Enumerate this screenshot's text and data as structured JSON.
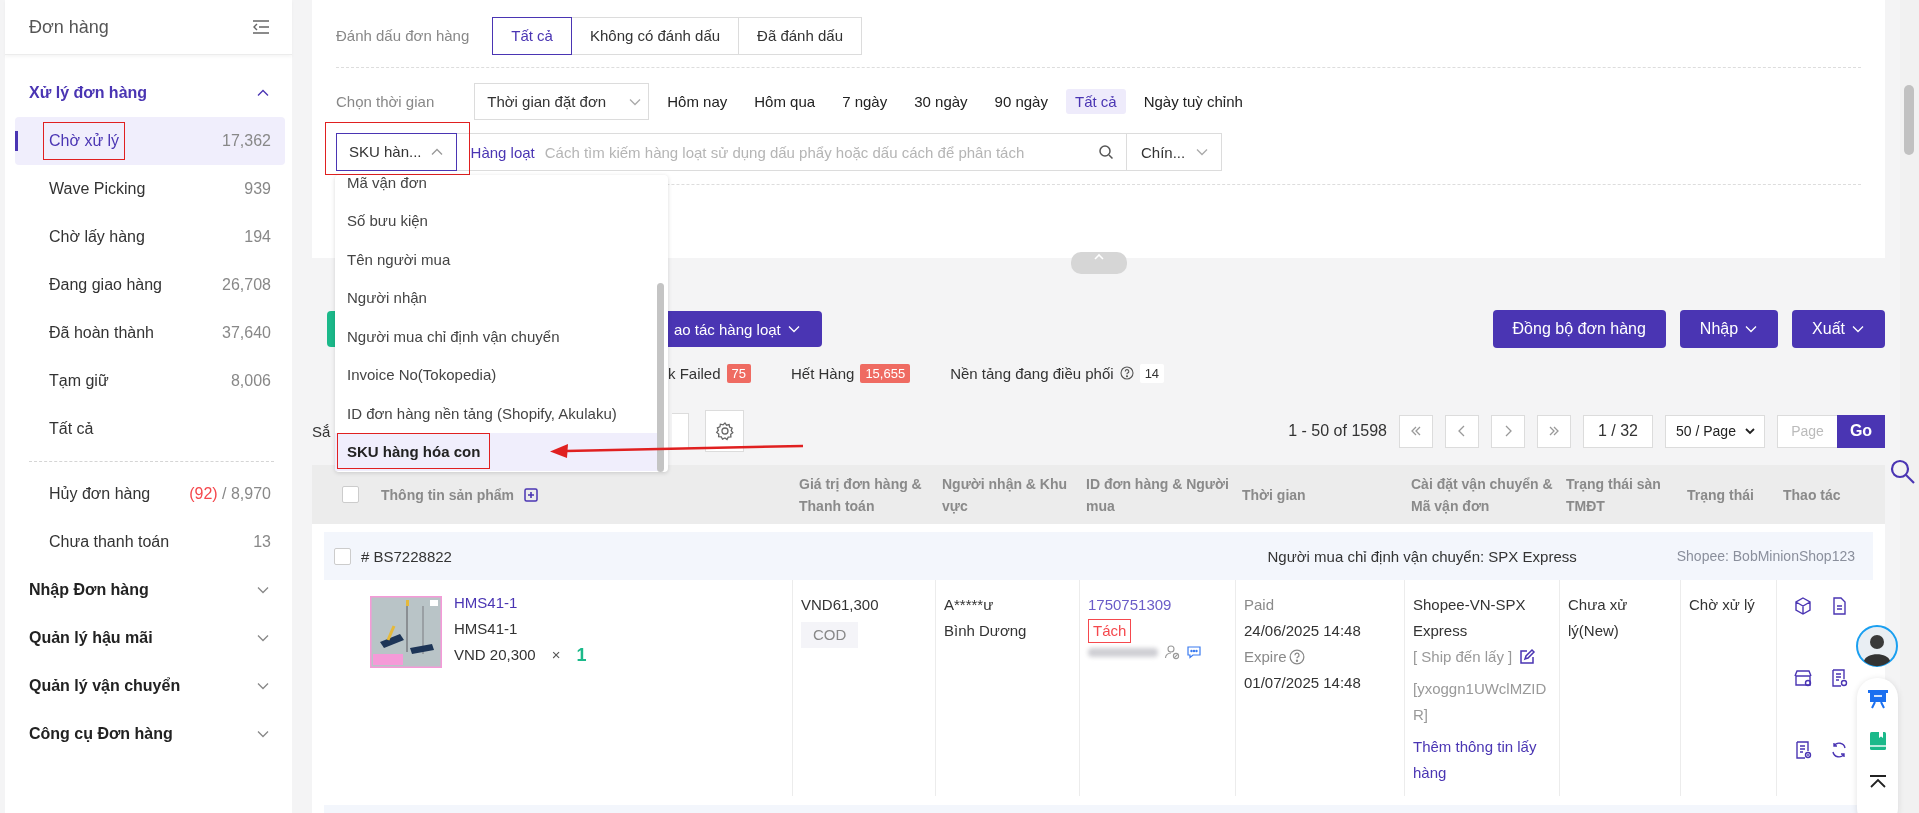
{
  "sidebar": {
    "title": "Đơn hàng",
    "groups": [
      {
        "label": "Xử lý đơn hàng",
        "expanded": true,
        "sections": [
          {
            "items": [
              {
                "label": "Chờ xử lý",
                "count": "17,362",
                "selected": true,
                "highlighted": true
              },
              {
                "label": "Wave Picking",
                "count": "939",
                "selected": false,
                "highlighted": false
              },
              {
                "label": "Chờ lấy hàng",
                "count": "194",
                "selected": false,
                "highlighted": false
              },
              {
                "label": "Đang giao hàng",
                "count": "26,708",
                "selected": false,
                "highlighted": false
              },
              {
                "label": "Đã hoàn thành",
                "count": "37,640",
                "selected": false,
                "highlighted": false
              },
              {
                "label": "Tạm giữ",
                "count": "8,006",
                "selected": false,
                "highlighted": false
              },
              {
                "label": "Tất cả",
                "selected": false,
                "highlighted": false
              }
            ]
          },
          {
            "items": [
              {
                "label": "Hủy đơn hàng",
                "alert_count": "(92)",
                "count": "/ 8,970",
                "selected": false,
                "highlighted": false
              },
              {
                "label": "Chưa thanh toán",
                "count": "13",
                "selected": false,
                "highlighted": false
              }
            ]
          }
        ]
      },
      {
        "label": "Nhập Đơn hàng",
        "expanded": false
      },
      {
        "label": "Quản lý hậu mãi",
        "expanded": false
      },
      {
        "label": "Quản lý vận chuyển",
        "expanded": false
      },
      {
        "label": "Công cụ Đơn hàng",
        "expanded": false
      }
    ]
  },
  "mark_filter": {
    "label": "Đánh dấu đơn hàng",
    "options": [
      {
        "label": "Tất cả",
        "selected": true
      },
      {
        "label": "Không có đánh dấu",
        "selected": false
      },
      {
        "label": "Đã đánh dấu",
        "selected": false
      }
    ]
  },
  "time_filter": {
    "label": "Chọn thời gian",
    "select": "Thời gian đặt đơn",
    "presets": [
      {
        "label": "Hôm nay",
        "selected": false
      },
      {
        "label": "Hôm qua",
        "selected": false
      },
      {
        "label": "7 ngày",
        "selected": false
      },
      {
        "label": "30 ngày",
        "selected": false
      },
      {
        "label": "90 ngày",
        "selected": false
      },
      {
        "label": "Tất cả",
        "selected": true
      },
      {
        "label": "Ngày tuỳ chỉnh",
        "selected": false
      }
    ]
  },
  "search": {
    "field_select": {
      "value": "SKU hàn...",
      "open": true,
      "highlighted": true
    },
    "batch_link": "Hàng loạt",
    "placeholder": "Cách tìm kiếm hàng loạt sử dụng dấu phẩy hoặc dấu cách để phân tách",
    "match_select": "Chín..."
  },
  "dropdown": {
    "items": [
      {
        "label": "Mã vận đơn",
        "selected": false,
        "highlighted": false
      },
      {
        "label": "Số bưu kiện",
        "selected": false,
        "highlighted": false
      },
      {
        "label": "Tên người mua",
        "selected": false,
        "highlighted": false
      },
      {
        "label": "Người nhận",
        "selected": false,
        "highlighted": false
      },
      {
        "label": "Người mua chỉ định vận chuyển",
        "selected": false,
        "highlighted": false
      },
      {
        "label": "Invoice No(Tokopedia)",
        "selected": false,
        "highlighted": false
      },
      {
        "label": "ID đơn hàng nền tảng (Shopify, Akulaku)",
        "selected": false,
        "highlighted": false
      },
      {
        "label": "SKU hàng hóa con",
        "selected": true,
        "highlighted": true
      }
    ]
  },
  "toolbar": {
    "batch_button": "ao tác hàng loạt",
    "right_buttons": [
      {
        "label": "Đồng bộ đơn hàng",
        "caret": false
      },
      {
        "label": "Nhập",
        "caret": true
      },
      {
        "label": "Xuất",
        "caret": true
      }
    ]
  },
  "status_tabs": [
    {
      "label": "k Failed",
      "count": "75",
      "kind": "alert"
    },
    {
      "label": "Hết Hàng",
      "count": "15,655",
      "kind": "alert"
    },
    {
      "label": "Nền tảng đang điều phối",
      "count": "14",
      "kind": "info"
    }
  ],
  "sort_label": "Sắ",
  "pagination": {
    "range": "1 - 50 of 1598",
    "page": "1 / 32",
    "page_size": "50 / Page",
    "page_placeholder": "Page",
    "go": "Go"
  },
  "table": {
    "all_checked": false,
    "columns": [
      "Thông tin sản phẩm",
      "Giá trị đơn hàng & Thanh toán",
      "Người nhận & Khu vực",
      "ID đơn hàng & Người mua",
      "Thời gian",
      "Cài đặt vận chuyển & Mã vận đơn",
      "Trạng thái sàn TMĐT",
      "Trạng thái",
      "Thao tác"
    ],
    "orders": [
      {
        "order_no": "# BS7228822",
        "checked": false,
        "carrier_note": "Người mua chỉ định vận chuyển: SPX Express",
        "shop": "Shopee: BobMinionShop123",
        "product_link": "HMS41-1",
        "sku": "HMS41-1",
        "price": "VND 20,300",
        "times": "×",
        "qty": "1",
        "total": "VND61,300",
        "payment": "COD",
        "recipient": "A*****ư",
        "region": "Bình Dương",
        "platform_id": "1750751309",
        "tag": "Tách",
        "paid_label": "Paid",
        "paid_time": "24/06/2025 14:48",
        "expire_label": "Expire",
        "expire_time": "01/07/2025 14:48",
        "carrier": "Shopee-VN-SPX Express",
        "ship_mode": "[ Ship đến lấy ]",
        "tracking": "[yxoggn1UWclMZIDR]",
        "add_pickup": "Thêm thông tin lấy hàng",
        "platform_status": "Chưa xử lý(New)",
        "status": "Chờ xử lý"
      }
    ]
  }
}
